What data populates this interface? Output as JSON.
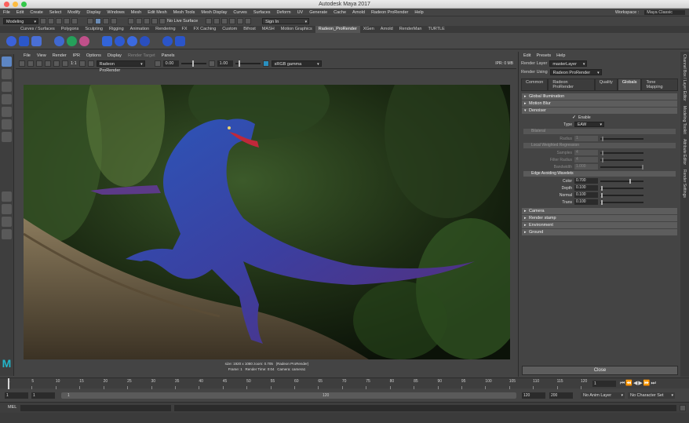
{
  "window": {
    "title": "Autodesk Maya 2017"
  },
  "menubar": [
    "File",
    "Edit",
    "Create",
    "Select",
    "Modify",
    "Display",
    "Windows",
    "Mesh",
    "Edit Mesh",
    "Mesh Tools",
    "Mesh Display",
    "Curves",
    "Surfaces",
    "Deform",
    "UV",
    "Generate",
    "Cache",
    "Arnold",
    "Radeon ProRender",
    "Help"
  ],
  "workspace": {
    "label": "Workspace :",
    "value": "Maya Classic"
  },
  "statusline": {
    "mode": "Modeling",
    "live_surface": "No Live Surface",
    "sign_in": "Sign In"
  },
  "shelf_tabs": [
    "Curves / Surfaces",
    "Polygons",
    "Sculpting",
    "Rigging",
    "Animation",
    "Rendering",
    "FX",
    "FX Caching",
    "Custom",
    "Bifrost",
    "MASH",
    "Motion Graphics",
    "Radeon_ProRender",
    "XGen",
    "Arnold",
    "RenderMan",
    "TURTLE"
  ],
  "shelf_active": "Radeon_ProRender",
  "viewport": {
    "menus": [
      "File",
      "View",
      "Render",
      "IPR",
      "Options",
      "Display",
      "Render Target",
      "Panels"
    ],
    "ratio": "1:1",
    "renderer": "Radeon ProRender",
    "exposure": "0.00",
    "gamma": "1.00",
    "colorspace": "sRGB gamma",
    "ipr": "IPR: 0 MB",
    "status": {
      "size": "size: 1920 x 1080 zoom: 0.705",
      "renderer": "(Radeon ProRender)",
      "frame": "Frame: 1",
      "time": "Render Time: 0:04",
      "camera": "Camera: camera1"
    }
  },
  "render_settings": {
    "menus": [
      "Edit",
      "Presets",
      "Help"
    ],
    "render_layer_label": "Render Layer",
    "render_layer": "masterLayer",
    "render_using_label": "Render Using",
    "render_using": "Radeon ProRender",
    "tabs": [
      "Common",
      "Radeon ProRender",
      "Quality",
      "Globals",
      "Tone Mapping"
    ],
    "active_tab": "Globals",
    "sections_top": [
      "Global Illumination",
      "Motion Blur"
    ],
    "denoiser": {
      "title": "Denoiser",
      "enable": "Enable",
      "type_label": "Type",
      "type": "EAW",
      "bilateral": "Bilateral",
      "radius_label": "Radius",
      "radius": "1",
      "lwr": "Local Weighted Regression",
      "samples_label": "Samples",
      "samples": "4",
      "filter_radius_label": "Filter Radius",
      "filter_radius": "4",
      "bandwidth_label": "Bandwidth",
      "bandwidth": "1.000",
      "eaw": "Edge Avoiding Wavelets",
      "eaw_params": [
        {
          "label": "Color",
          "value": "0.700",
          "pos": 0.7
        },
        {
          "label": "Depth",
          "value": "0.100",
          "pos": 0.02
        },
        {
          "label": "Normal",
          "value": "0.100",
          "pos": 0.02
        },
        {
          "label": "Trans",
          "value": "0.100",
          "pos": 0.02
        }
      ]
    },
    "sections_bottom": [
      "Camera",
      "Render stamp",
      "Environment",
      "Ground"
    ],
    "close": "Close"
  },
  "side_tabs": [
    "Channel Box / Layer Editor",
    "Modeling Toolkit",
    "Attribute Editor",
    "Render Settings"
  ],
  "timeline": {
    "ticks": [
      "1",
      "5",
      "10",
      "15",
      "20",
      "25",
      "30",
      "35",
      "40",
      "45",
      "50",
      "55",
      "60",
      "65",
      "70",
      "75",
      "80",
      "85",
      "90",
      "95",
      "100",
      "105",
      "110",
      "115",
      "120"
    ],
    "current": "1"
  },
  "range": {
    "start": "1",
    "inner_start": "1",
    "inner_start_slider": "1",
    "inner_end_slider": "120",
    "inner_end": "120",
    "end": "200",
    "anim_layer": "No Anim Layer",
    "char_set": "No Character Set"
  },
  "cmdline": {
    "label": "MEL"
  }
}
